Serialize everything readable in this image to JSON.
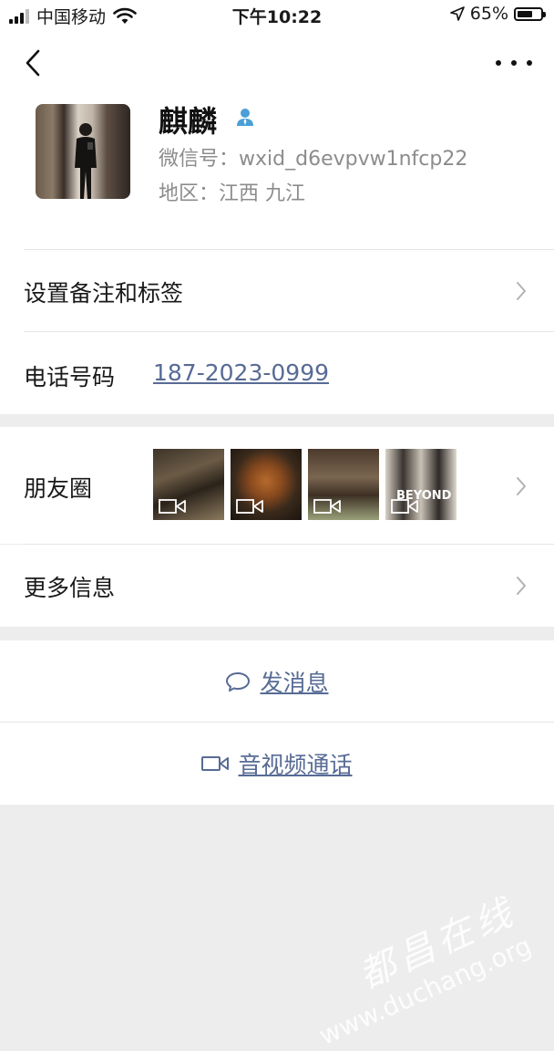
{
  "status_bar": {
    "carrier": "中国移动",
    "time": "下午10:22",
    "battery_text": "65%",
    "battery_level": 0.65
  },
  "profile": {
    "name": "麒麟",
    "wechat_id_label": "微信号：",
    "wechat_id": "wxid_d6evpvw1nfcp22",
    "region_label": "地区：",
    "region": "江西 九江"
  },
  "rows": {
    "remark_label": "设置备注和标签",
    "phone_label": "电话号码",
    "phone_value": "187-2023-0999",
    "moments_label": "朋友圈",
    "more_info_label": "更多信息"
  },
  "moments_thumbs": [
    {
      "icon": "video-camera-icon"
    },
    {
      "icon": "video-camera-icon"
    },
    {
      "icon": "video-camera-icon"
    },
    {
      "icon": "video-camera-icon",
      "text": "BEYOND"
    }
  ],
  "actions": {
    "message_label": "发消息",
    "call_label": "音视频通话"
  },
  "watermark": {
    "chinese": "都昌在线",
    "url": "www.duchang.org"
  },
  "colors": {
    "link": "#576b95",
    "background": "#ededed",
    "secondary_text": "#8c8c8c",
    "contact_icon": "#4a9fd8"
  }
}
